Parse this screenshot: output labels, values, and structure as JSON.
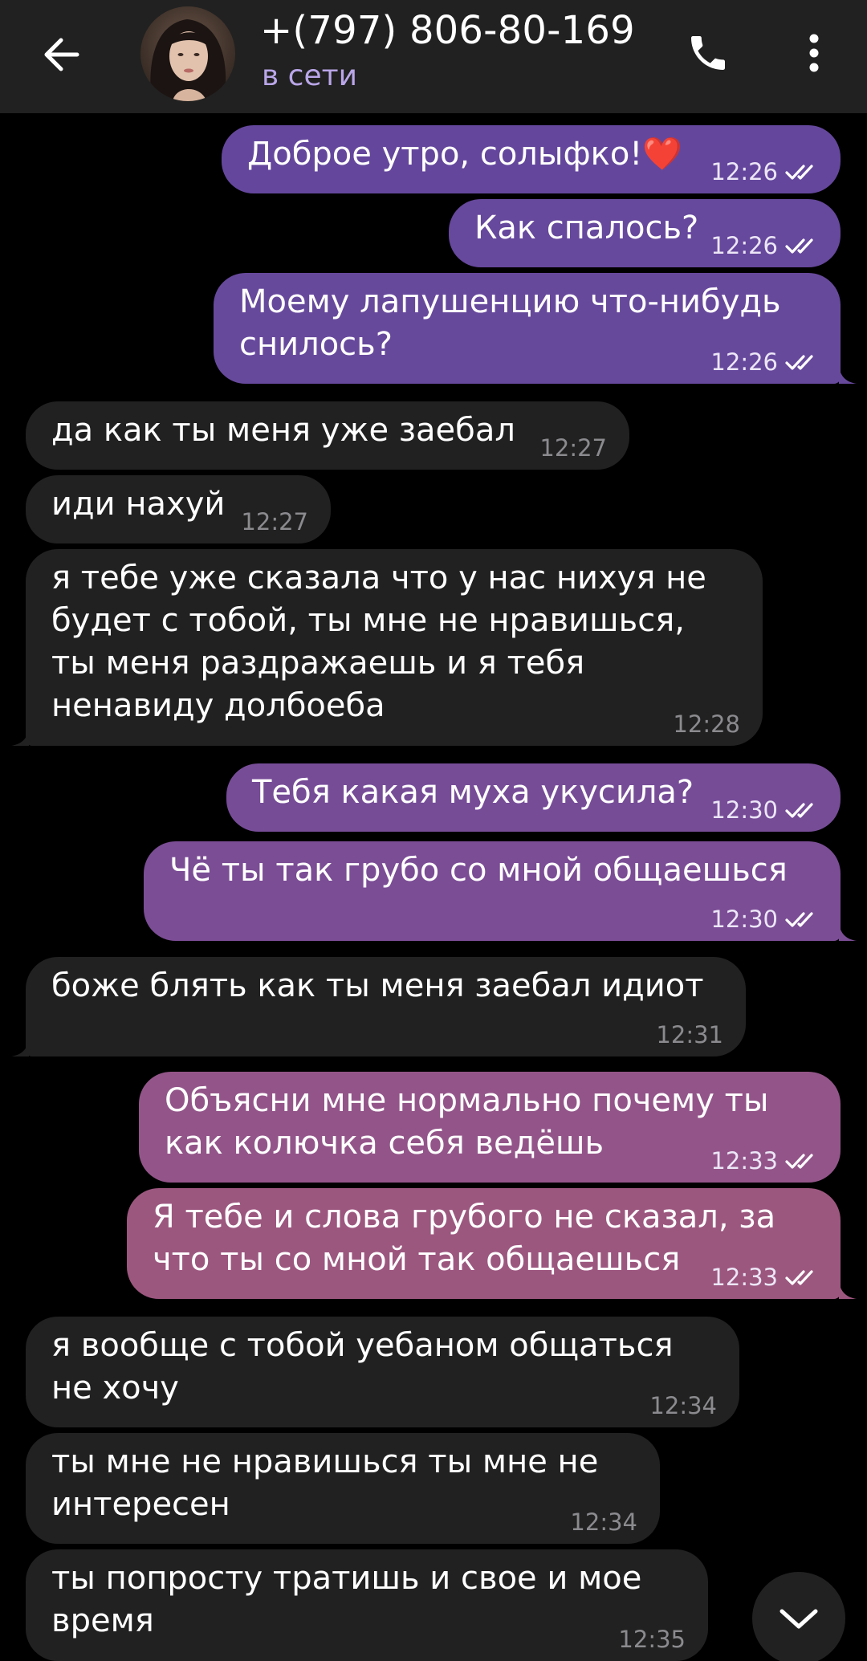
{
  "header": {
    "contact_name": "+(797) 806-80-169",
    "status": "в сети",
    "icons": {
      "back": "arrow-left-icon",
      "call": "phone-icon",
      "more": "vertical-dots-icon"
    }
  },
  "colors": {
    "header_bg": "#212121",
    "incoming_bg": "#212121",
    "status_text": "#b9a6e8",
    "outgoing_top": "#6f4aa3",
    "outgoing_bottom": "#a9566f"
  },
  "messages": [
    {
      "direction": "out",
      "text": "Доброе утро, солыфко!❤️",
      "time": "12:26",
      "read": true
    },
    {
      "direction": "out",
      "text": "Как спалось?",
      "time": "12:26",
      "read": true
    },
    {
      "direction": "out",
      "text": "Моему лапушенцию что-нибудь снилось?",
      "time": "12:26",
      "read": true
    },
    {
      "direction": "in",
      "text": "да как ты меня уже заебал",
      "time": "12:27"
    },
    {
      "direction": "in",
      "text": "иди нахуй",
      "time": "12:27"
    },
    {
      "direction": "in",
      "text": "я тебе уже сказала что у нас нихуя не будет с тобой, ты мне не нравишься, ты меня раздражаешь и я тебя ненавиду долбоеба",
      "time": "12:28"
    },
    {
      "direction": "out",
      "text": "Тебя какая муха укусила?",
      "time": "12:30",
      "read": true
    },
    {
      "direction": "out",
      "text": "Чё ты так грубо со мной общаешься",
      "time": "12:30",
      "read": true
    },
    {
      "direction": "in",
      "text": "боже блять как ты меня заебал идиот",
      "time": "12:31"
    },
    {
      "direction": "out",
      "text": "Объясни мне нормально почему ты как колючка себя ведёшь",
      "time": "12:33",
      "read": true
    },
    {
      "direction": "out",
      "text": "Я тебе и слова грубого не сказал, за что ты со мной так общаешься",
      "time": "12:33",
      "read": true
    },
    {
      "direction": "in",
      "text": "я вообще с тобой уебаном общаться не хочу",
      "time": "12:34"
    },
    {
      "direction": "in",
      "text": "ты мне не нравишься ты мне не интересен",
      "time": "12:34"
    },
    {
      "direction": "in",
      "text": "ты попросту тратишь и свое и мое время",
      "time": "12:35"
    }
  ],
  "scroll_down": {
    "icon": "chevron-down-icon"
  }
}
